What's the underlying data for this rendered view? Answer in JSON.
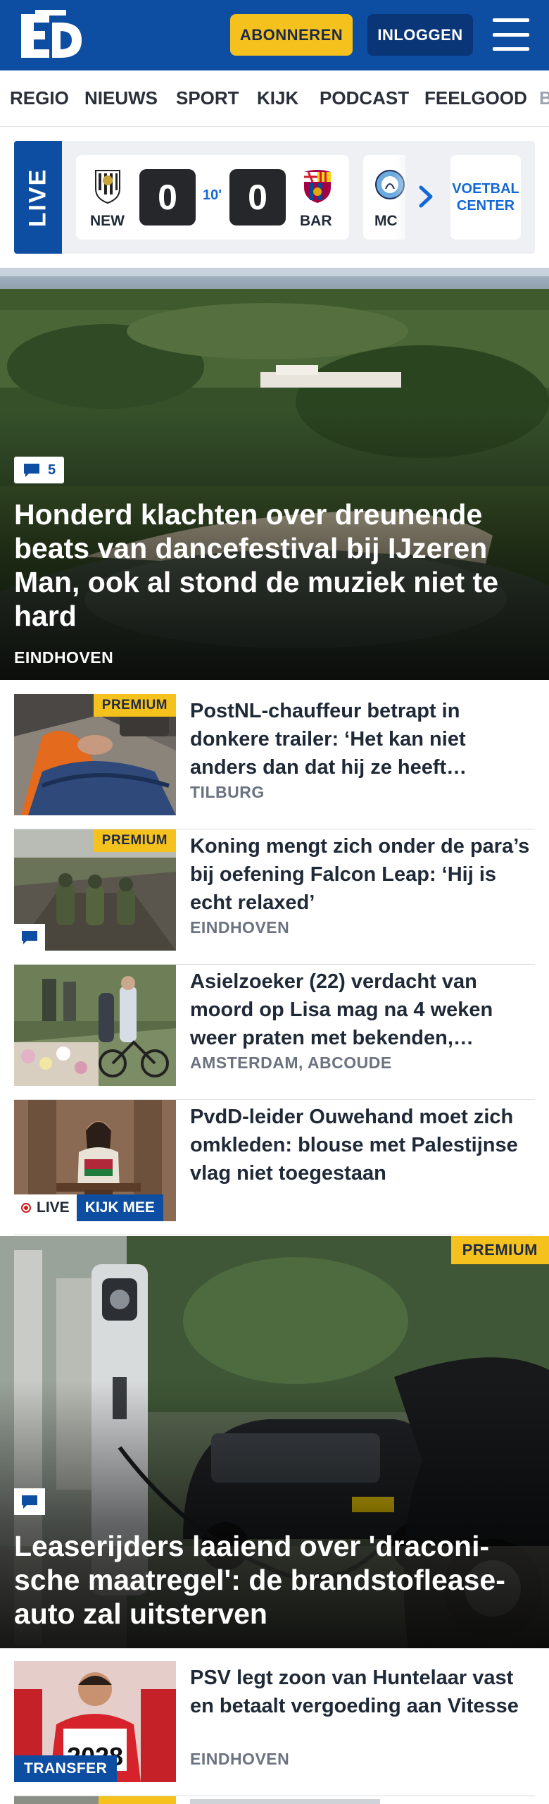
{
  "header": {
    "logo_text": "ED",
    "subscribe_label": "ABONNEREN",
    "login_label": "INLOGGEN"
  },
  "nav": {
    "items": [
      "REGIO",
      "NIEUWS",
      "SPORT",
      "KIJK",
      "PODCAST",
      "FEELGOOD",
      "B"
    ]
  },
  "live": {
    "tag": "LIVE",
    "match": {
      "home_team": "NEW",
      "away_team": "BAR",
      "home_score": "0",
      "away_score": "0",
      "minute": "10'"
    },
    "next_match_team": "MC",
    "football_center_label": "VOETBAL CENTER"
  },
  "hero": {
    "comment_count": "5",
    "title": "Honderd klachten over dreunende beats van dancefestival bij IJzeren Man, ook al stond de muziek niet te hard",
    "location": "EINDHOVEN"
  },
  "articles": [
    {
      "title": "PostNL-chauffeur betrapt in donkere trailer: ‘Het kan niet anders dan dat hij ze heeft…",
      "location": "TILBURG",
      "badge": "PREMIUM"
    },
    {
      "title": "Koning mengt zich onder de para’s bij oefening Falcon Leap: ‘Hij is echt relaxed’",
      "location": "EINDHOVEN",
      "badge": "PREMIUM"
    },
    {
      "title": "Asielzoeker (22) verdacht van moord op Lisa mag na 4 weken weer praten met bekenden,…",
      "location": "AMSTERDAM, ABCOUDE"
    },
    {
      "title": "PvdD-leider Ouwehand moet zich omkleden: blouse met Palestijn­se vlag niet toegestaan",
      "live_label": "LIVE",
      "watch_label": "KIJK MEE"
    }
  ],
  "hero2": {
    "badge": "PREMIUM",
    "title": "Leaserijders laaiend over 'draconi­sche maatregel': de brandstoflease­auto zal uitsterven"
  },
  "article_last": {
    "title": "PSV legt zoon van Huntelaar vast en betaalt vergoeding aan Vitesse",
    "location": "EINDHOVEN",
    "tag": "TRANSFER",
    "jersey_text": "2028"
  },
  "colors": {
    "brand_blue": "#0d4ea3",
    "accent_yellow": "#f5c11d",
    "dark_blue": "#0a3577"
  }
}
